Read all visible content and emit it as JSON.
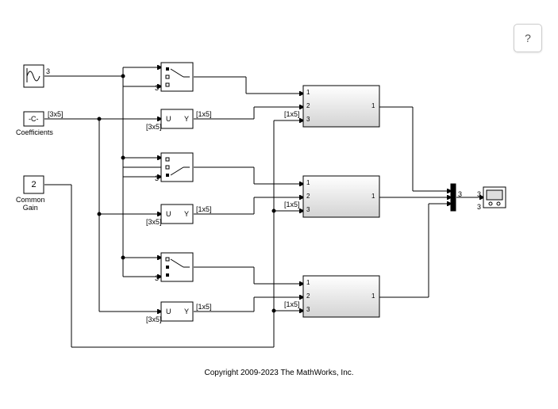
{
  "help": "?",
  "source1": {
    "dim": "3"
  },
  "source2": {
    "text": "-C-",
    "dim": "[3x5]",
    "label": "Coefficients"
  },
  "source3": {
    "text": "2",
    "label": "Common\nGain"
  },
  "selector": {
    "U": "U",
    "Y": "Y",
    "out_dim": "[1x5]",
    "in_dim": "[3x5]"
  },
  "subsystem": {
    "p1": "1",
    "p2": "2",
    "p3": "3",
    "out": "1",
    "indim": "[1x5]"
  },
  "mux": {
    "dim": "3"
  },
  "copyright": "Copyright 2009-2023 The MathWorks, Inc."
}
